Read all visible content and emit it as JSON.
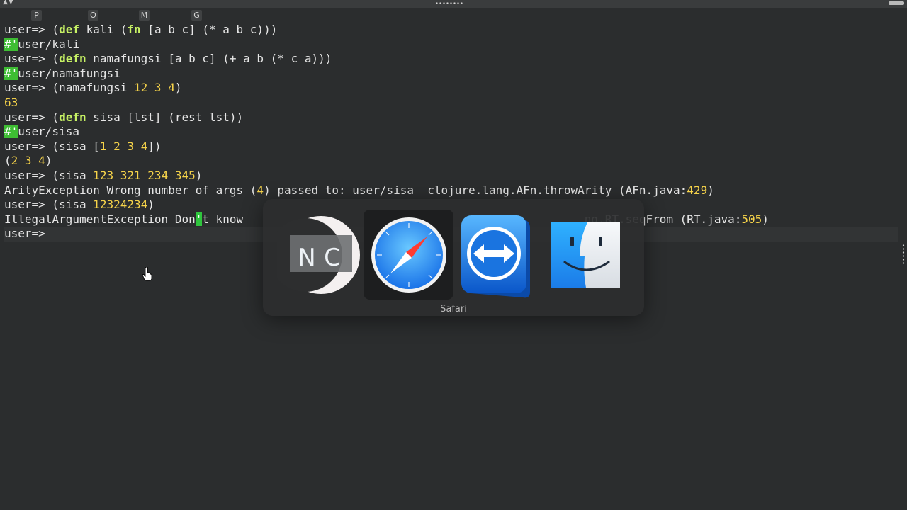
{
  "topbar": {
    "arrows": "▲▼"
  },
  "hints": [
    "P",
    "O",
    "M",
    "G"
  ],
  "terminal": {
    "lines": [
      [
        {
          "t": "user=> (",
          "c": ""
        },
        {
          "t": "def",
          "c": "kw"
        },
        {
          "t": " kali (",
          "c": ""
        },
        {
          "t": "fn",
          "c": "kw"
        },
        {
          "t": " [a b c] (* a b c)))",
          "c": ""
        }
      ],
      [
        {
          "t": "#'",
          "c": "quote-mark"
        },
        {
          "t": "user/kali",
          "c": ""
        }
      ],
      [
        {
          "t": "user=> (",
          "c": ""
        },
        {
          "t": "defn",
          "c": "kw"
        },
        {
          "t": " namafungsi [a b c] (+ a b (* c a)))",
          "c": ""
        }
      ],
      [
        {
          "t": "#'",
          "c": "quote-mark"
        },
        {
          "t": "user/namafungsi",
          "c": ""
        }
      ],
      [
        {
          "t": "user=> (namafungsi ",
          "c": ""
        },
        {
          "t": "12 3 4",
          "c": "num"
        },
        {
          "t": ")",
          "c": ""
        }
      ],
      [
        {
          "t": "63",
          "c": "num"
        }
      ],
      [
        {
          "t": "user=> (",
          "c": ""
        },
        {
          "t": "defn",
          "c": "kw"
        },
        {
          "t": " sisa [lst] (rest lst))",
          "c": ""
        }
      ],
      [
        {
          "t": "#'",
          "c": "quote-mark"
        },
        {
          "t": "user/sisa",
          "c": ""
        }
      ],
      [
        {
          "t": "user=> (sisa [",
          "c": ""
        },
        {
          "t": "1 2 3 4",
          "c": "num"
        },
        {
          "t": "])",
          "c": ""
        }
      ],
      [
        {
          "t": "(",
          "c": ""
        },
        {
          "t": "2 3 4",
          "c": "num"
        },
        {
          "t": ")",
          "c": ""
        }
      ],
      [
        {
          "t": "user=> (sisa ",
          "c": ""
        },
        {
          "t": "123 321 234 345",
          "c": "num"
        },
        {
          "t": ")",
          "c": ""
        }
      ],
      [
        {
          "t": "ArityException Wrong number of args (",
          "c": ""
        },
        {
          "t": "4",
          "c": "num"
        },
        {
          "t": ") passed to: user/sisa  clojure.lang.AFn.throwArity (AFn.java:",
          "c": ""
        },
        {
          "t": "429",
          "c": "num"
        },
        {
          "t": ")",
          "c": ""
        }
      ],
      [
        {
          "t": "user=> (sisa ",
          "c": ""
        },
        {
          "t": "12324234",
          "c": "num"
        },
        {
          "t": ")",
          "c": ""
        }
      ],
      [
        {
          "t": "IllegalArgumentException Don",
          "c": ""
        },
        {
          "t": "'",
          "c": "cursor-hl"
        },
        {
          "t": "t know                                                  ng.RT.seqFrom (RT.java:",
          "c": ""
        },
        {
          "t": "505",
          "c": "num"
        },
        {
          "t": ")",
          "c": ""
        }
      ],
      [
        {
          "t": "user=> ",
          "c": ""
        }
      ]
    ]
  },
  "switcher": {
    "selected_label": "Safari",
    "apps": [
      {
        "name": "nc-app-icon",
        "letters": [
          "N",
          "C"
        ]
      },
      {
        "name": "safari-icon"
      },
      {
        "name": "teamviewer-icon"
      },
      {
        "name": "finder-icon"
      }
    ]
  },
  "colors": {
    "background": "#2b2d2e",
    "keyword": "#c7f264",
    "number": "#f7d44a",
    "quote_highlight": "#3ebd33"
  }
}
